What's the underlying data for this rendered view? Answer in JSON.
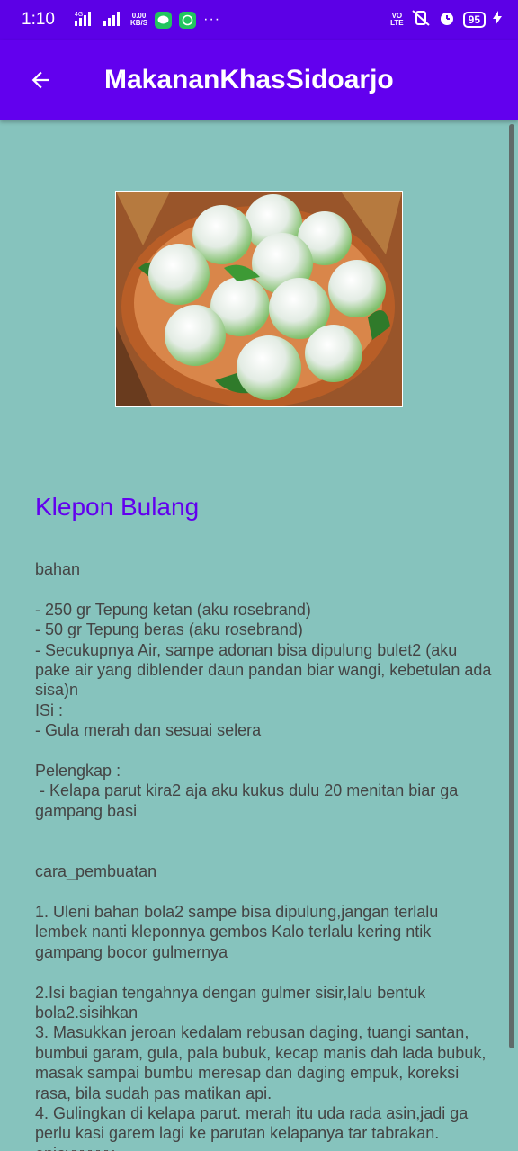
{
  "status_bar": {
    "time": "1:10",
    "network_type": "4G",
    "speed_value": "0.00",
    "speed_unit": "KB/S",
    "volte_top": "VO",
    "volte_bottom": "LTE",
    "battery": "95"
  },
  "app_bar": {
    "title": "MakananKhasSidoarjo"
  },
  "recipe": {
    "title": "Klepon Bulang",
    "body": "bahan\n\n- 250 gr Tepung ketan (aku rosebrand)\n- 50 gr Tepung beras (aku rosebrand)\n- Secukupnya Air, sampe adonan bisa dipulung bulet2 (aku pake air yang diblender daun pandan biar wangi, kebetulan ada sisa)n\nISi :\n- Gula merah dan sesuai selera\n\nPelengkap :\n - Kelapa parut kira2 aja aku kukus dulu 20 menitan biar ga gampang basi\n\n\ncara_pembuatan\n\n1. Uleni bahan bola2 sampe bisa dipulung,jangan terlalu lembek nanti kleponnya gembos Kalo terlalu kering ntik gampang bocor gulmernya\n\n2.Isi bagian tengahnya dengan gulmer sisir,lalu bentuk bola2.sisihkan\n3. Masukkan jeroan kedalam rebusan daging, tuangi santan, bumbui garam, gula, pala bubuk, kecap manis dah lada bubuk, masak sampai bumbu meresap dan daging empuk, koreksi rasa, bila sudah pas matikan api.\n4. Gulingkan di kelapa parut. merah itu uda rada asin,jadi ga perlu kasi garem lagi ke parutan kelapanya tar tabrakan. enjoyyyyyy"
  },
  "colors": {
    "primary": "#6200ee",
    "status_bar": "#5c00e6",
    "background": "#86c3bd",
    "body_text": "#444444"
  }
}
